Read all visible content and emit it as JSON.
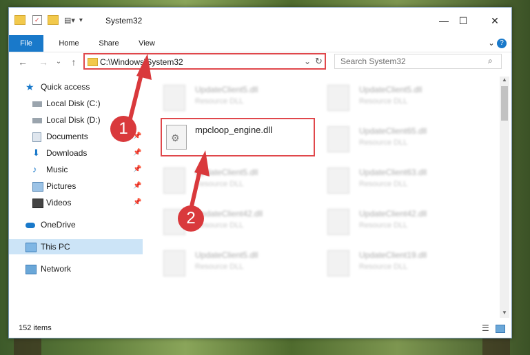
{
  "window": {
    "title": "System32",
    "minimize": "—",
    "maximize": "☐",
    "close": "✕"
  },
  "ribbon": {
    "tabs": [
      "File",
      "Home",
      "Share",
      "View"
    ],
    "help": "?"
  },
  "address": {
    "path": "C:\\Windows\\System32",
    "search_placeholder": "Search System32"
  },
  "sidebar": {
    "items": [
      {
        "label": "Quick access",
        "icon": "star-icon",
        "pinned": false
      },
      {
        "label": "Local Disk (C:)",
        "icon": "drive-icon",
        "pinned": false
      },
      {
        "label": "Local Disk (D:)",
        "icon": "drive-icon",
        "pinned": false
      },
      {
        "label": "Documents",
        "icon": "documents-icon",
        "pinned": true
      },
      {
        "label": "Downloads",
        "icon": "download-icon",
        "pinned": true
      },
      {
        "label": "Music",
        "icon": "music-icon",
        "pinned": true
      },
      {
        "label": "Pictures",
        "icon": "pictures-icon",
        "pinned": true
      },
      {
        "label": "Videos",
        "icon": "videos-icon",
        "pinned": true
      },
      {
        "label": "OneDrive",
        "icon": "cloud-icon",
        "pinned": false
      },
      {
        "label": "This PC",
        "icon": "computer-icon",
        "pinned": false
      },
      {
        "label": "Network",
        "icon": "network-icon",
        "pinned": false
      }
    ]
  },
  "files": [
    {
      "name": "UpdateClient5.dll",
      "type": "Resource DLL"
    },
    {
      "name": "UpdateClient5.dll",
      "type": "Resource DLL"
    },
    {
      "name": "UpdateClient65.dll",
      "type": "Resource DLL"
    },
    {
      "name": "UpdateClient5.dll",
      "type": "Resource DLL"
    },
    {
      "name": "UpdateClient63.dll",
      "type": "Resource DLL"
    },
    {
      "name": "UpdateClient42.dll",
      "type": "Resource DLL"
    },
    {
      "name": "UpdateClient42.dll",
      "type": "Resource DLL"
    },
    {
      "name": "UpdateClient5.dll",
      "type": "Resource DLL"
    },
    {
      "name": "UpdateClient19.dll",
      "type": "Resource DLL"
    }
  ],
  "selected_file": {
    "name": "mpcloop_engine.dll"
  },
  "status": {
    "count": "152 items"
  },
  "annotations": {
    "step1": "1",
    "step2": "2"
  },
  "colors": {
    "accent": "#1979ca",
    "highlight": "#e0474b"
  }
}
